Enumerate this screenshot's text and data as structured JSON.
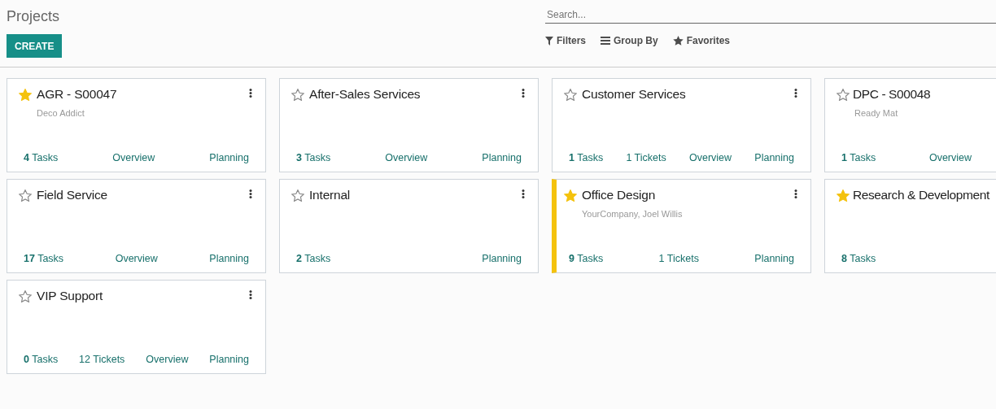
{
  "breadcrumb": "Projects",
  "create_button": "CREATE",
  "search": {
    "placeholder": "Search..."
  },
  "filters": [
    {
      "kind": "filter",
      "label": "Filters"
    },
    {
      "kind": "group",
      "label": "Group By"
    },
    {
      "kind": "favorite",
      "label": "Favorites"
    }
  ],
  "projects": [
    {
      "name": "AGR - S00047",
      "starred": true,
      "customer": "Deco Addict",
      "links": [
        "**4** Tasks",
        "Overview",
        "Planning"
      ]
    },
    {
      "name": "After-Sales Services",
      "starred": false,
      "links": [
        "**3** Tasks",
        "Overview",
        "Planning"
      ]
    },
    {
      "name": "Customer Services",
      "starred": false,
      "links": [
        "**1** Tasks",
        "1 Tickets",
        "Overview",
        "Planning"
      ]
    },
    {
      "name": "DPC - S00048",
      "starred": false,
      "customer": "Ready Mat",
      "links": [
        "**1** Tasks",
        "Overview"
      ]
    },
    {
      "name": "Field Service",
      "starred": false,
      "links": [
        "**17** Tasks",
        "Overview",
        "Planning"
      ]
    },
    {
      "name": "Internal",
      "starred": false,
      "links": [
        "**2** Tasks",
        "Planning"
      ]
    },
    {
      "name": "Office Design",
      "starred": true,
      "color": "#f4c20d",
      "customer": "YourCompany, Joel Willis",
      "links": [
        "**9** Tasks",
        "1 Tickets",
        "Planning"
      ]
    },
    {
      "name": "Research & Development",
      "starred": true,
      "links": [
        "**8** Tasks"
      ]
    },
    {
      "name": "VIP Support",
      "starred": false,
      "links": [
        "**0** Tasks",
        "12 Tickets",
        "Overview",
        "Planning"
      ]
    }
  ]
}
